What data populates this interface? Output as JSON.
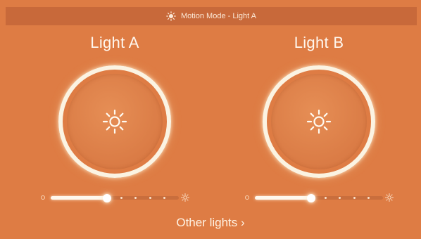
{
  "header": {
    "icon": "sun-icon",
    "title": "Motion Mode - Light A"
  },
  "lights": [
    {
      "name": "Light A",
      "power_icon": "sun-icon",
      "brightness": 0.44,
      "brightness_steps": 5
    },
    {
      "name": "Light B",
      "power_icon": "sun-icon",
      "brightness": 0.44,
      "brightness_steps": 5
    }
  ],
  "footer": {
    "link": "Other lights ›"
  },
  "colors": {
    "background": "#de7c44",
    "title_bar": "#c8693a",
    "ring": "#fbf3e2",
    "text": "#fff7ee"
  }
}
